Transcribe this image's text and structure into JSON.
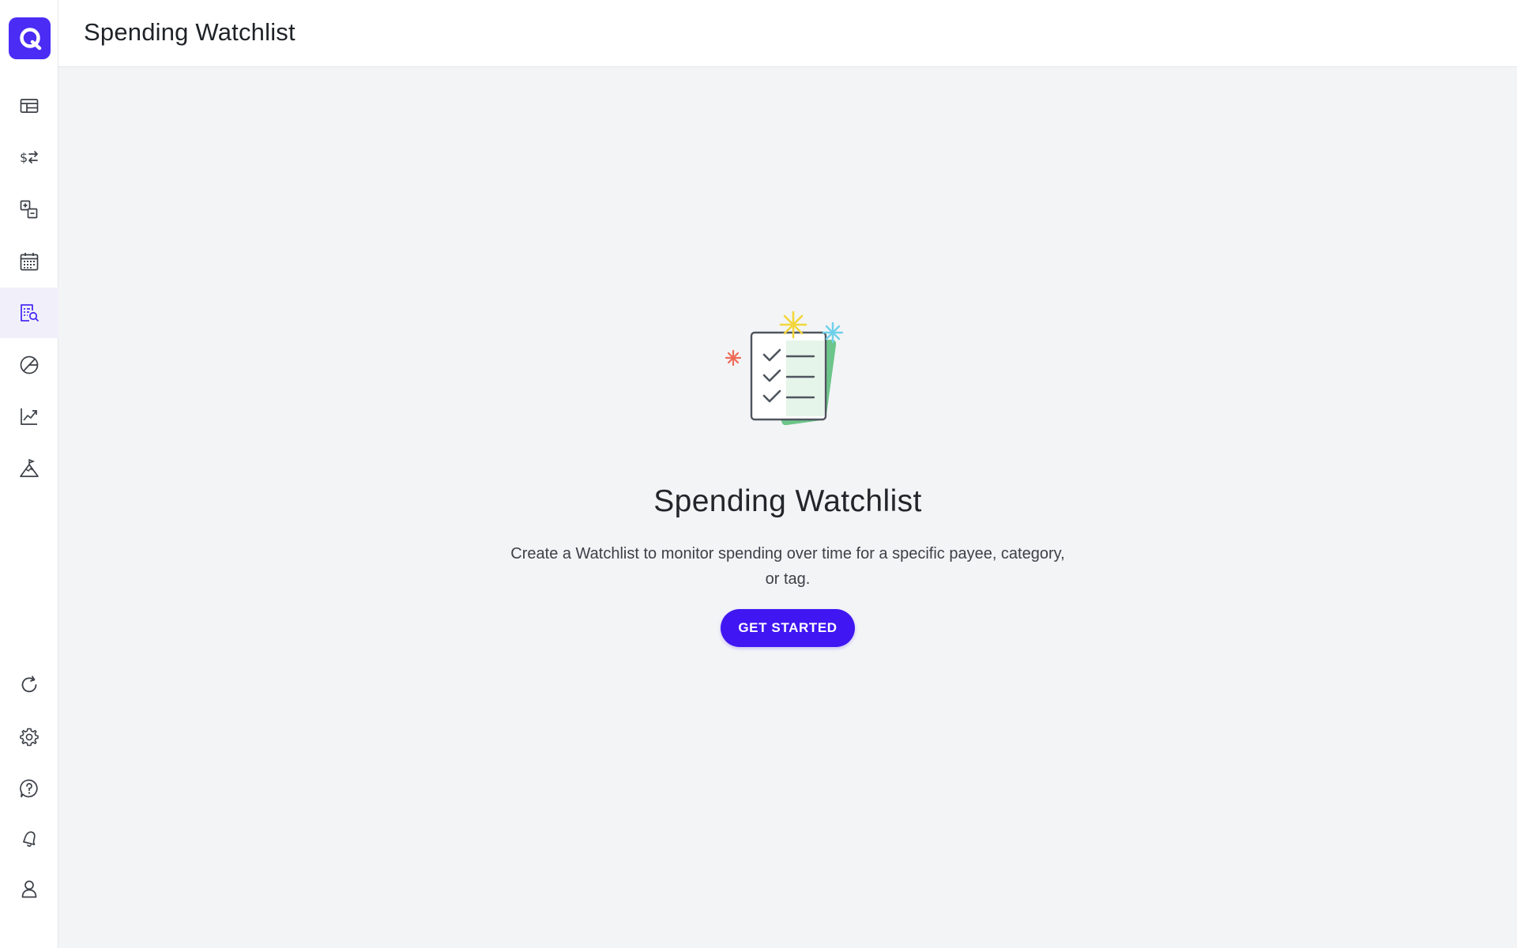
{
  "app": {
    "page_title": "Spending Watchlist"
  },
  "colors": {
    "brand": "#4a2cf5",
    "button": "#4016f2",
    "active_nav_bg": "#f1f0fa",
    "background": "#f3f4f6"
  },
  "sidebar": {
    "logo_icon": "quicken-logo-icon",
    "top_items": [
      {
        "name": "dashboard",
        "icon": "dashboard-icon",
        "active": false
      },
      {
        "name": "transactions",
        "icon": "dollar-exchange-icon",
        "active": false
      },
      {
        "name": "budgets",
        "icon": "plus-minus-icon",
        "active": false
      },
      {
        "name": "bills",
        "icon": "calendar-icon",
        "active": false
      },
      {
        "name": "spending-watchlist",
        "icon": "report-search-icon",
        "active": true
      },
      {
        "name": "reports",
        "icon": "pie-chart-icon",
        "active": false
      },
      {
        "name": "investments",
        "icon": "trend-chart-icon",
        "active": false
      },
      {
        "name": "planning",
        "icon": "mountain-flag-icon",
        "active": false
      }
    ],
    "bottom_items": [
      {
        "name": "refresh",
        "icon": "refresh-icon"
      },
      {
        "name": "settings",
        "icon": "gear-icon"
      },
      {
        "name": "help",
        "icon": "help-icon"
      },
      {
        "name": "notifications",
        "icon": "bell-icon"
      },
      {
        "name": "profile",
        "icon": "user-icon"
      }
    ]
  },
  "empty_state": {
    "illustration": "checklist-illustration",
    "title": "Spending Watchlist",
    "description": "Create a Watchlist to monitor spending over time for a specific payee, category, or tag.",
    "button_label": "GET STARTED"
  }
}
